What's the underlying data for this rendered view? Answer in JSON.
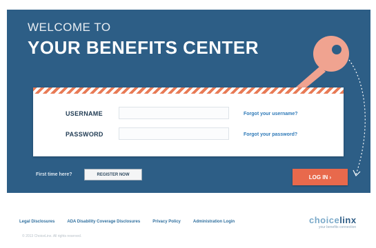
{
  "header": {
    "welcome": "WELCOME TO",
    "title": "YOUR BENEFITS CENTER"
  },
  "form": {
    "username_label": "USERNAME",
    "password_label": "PASSWORD",
    "username_value": "",
    "password_value": "",
    "forgot_username": "Forgot your username?",
    "forgot_password": "Forgot your password?"
  },
  "actions": {
    "first_time": "First time here?",
    "register": "REGISTER NOW",
    "login": "LOG IN ›"
  },
  "footer": {
    "links": [
      "Legal Disclosures",
      "ADA Disability Coverage Disclosures",
      "Privacy Policy",
      "Administration Login"
    ],
    "copyright": "© 2013 ChoiceLinx. All rights reserved.",
    "logo_word_a": "choice",
    "logo_word_b": "linx",
    "logo_tagline": "your benefits connection"
  },
  "colors": {
    "panel": "#2d5e86",
    "accent": "#e8694c",
    "link": "#2f7ab8"
  }
}
